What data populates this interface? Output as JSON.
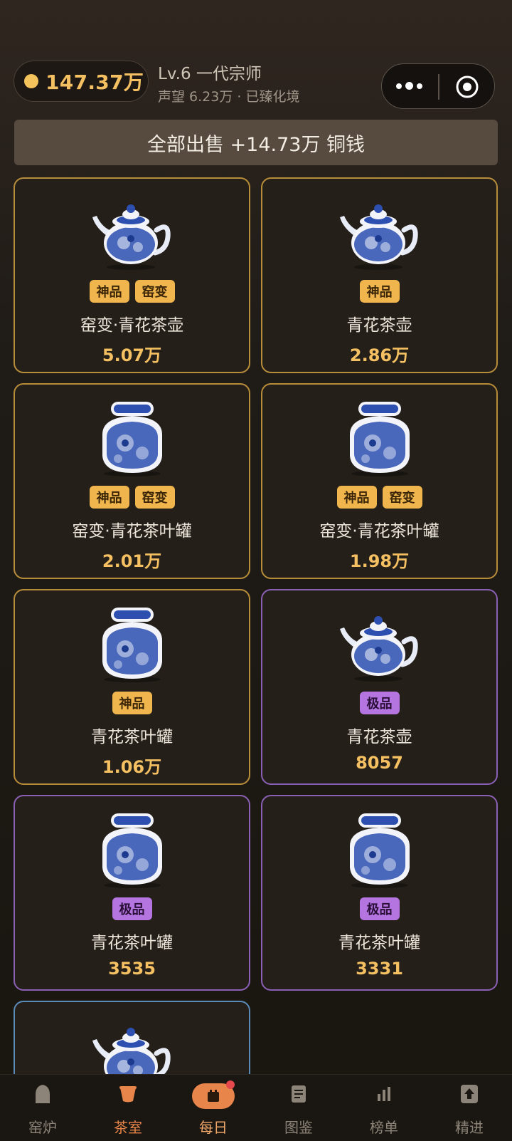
{
  "header": {
    "coins": "147.37万",
    "level": "Lv.6 一代宗师",
    "subtitle": "声望 6.23万 · 已臻化境"
  },
  "sell_all": {
    "label": "全部出售  +14.73万 铜钱"
  },
  "items": [
    {
      "name": "窑变·青花茶壶",
      "price": "5.07万",
      "tags": [
        "神品",
        "窑变"
      ],
      "kind": "teapot",
      "rarity": "gold"
    },
    {
      "name": "青花茶壶",
      "price": "2.86万",
      "tags": [
        "神品"
      ],
      "kind": "teapot",
      "rarity": "gold"
    },
    {
      "name": "窑变·青花茶叶罐",
      "price": "2.01万",
      "tags": [
        "神品",
        "窑变"
      ],
      "kind": "jar",
      "rarity": "gold"
    },
    {
      "name": "窑变·青花茶叶罐",
      "price": "1.98万",
      "tags": [
        "神品",
        "窑变"
      ],
      "kind": "jar",
      "rarity": "gold"
    },
    {
      "name": "青花茶叶罐",
      "price": "1.06万",
      "tags": [
        "神品"
      ],
      "kind": "jar",
      "rarity": "gold"
    },
    {
      "name": "青花茶壶",
      "price": "8057",
      "tags": [
        "极品"
      ],
      "kind": "teapot",
      "rarity": "purple"
    },
    {
      "name": "青花茶叶罐",
      "price": "3535",
      "tags": [
        "极品"
      ],
      "kind": "jar",
      "rarity": "purple"
    },
    {
      "name": "青花茶叶罐",
      "price": "3331",
      "tags": [
        "极品"
      ],
      "kind": "jar",
      "rarity": "purple"
    },
    {
      "name": "",
      "price": "",
      "tags": [],
      "kind": "teapot",
      "rarity": "blue"
    }
  ],
  "nav": [
    {
      "label": "窑炉",
      "icon": "kiln-icon"
    },
    {
      "label": "茶室",
      "icon": "teacup-icon",
      "active": true
    },
    {
      "label": "每日",
      "icon": "calendar-icon",
      "badge": true
    },
    {
      "label": "图鉴",
      "icon": "book-icon"
    },
    {
      "label": "榜单",
      "icon": "bar-chart-icon"
    },
    {
      "label": "精进",
      "icon": "upgrade-icon"
    }
  ],
  "colors": {
    "gold": "#f4c062",
    "gold_border": "#b88d3a",
    "purple_border": "#8a60b4",
    "blue_border": "#5a8ab8",
    "accent": "#e8854a"
  }
}
